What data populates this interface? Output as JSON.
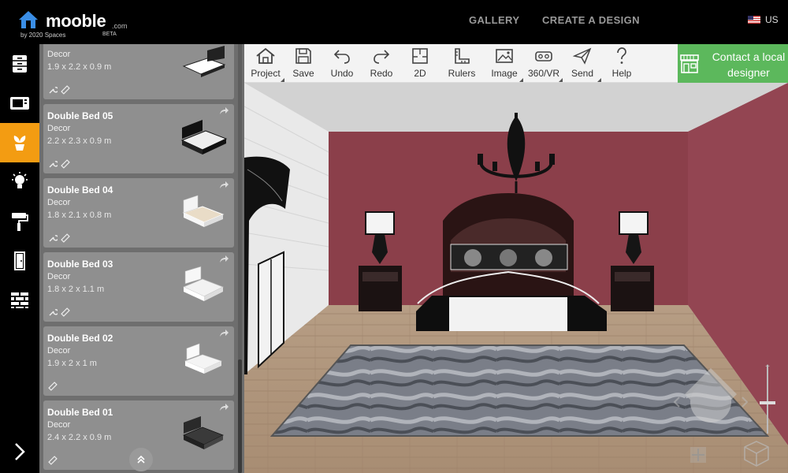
{
  "brand": {
    "name": "mooble",
    "tld": ".com",
    "byline": "by 2020 Spaces",
    "tag": "BETA"
  },
  "nav": {
    "gallery": "GALLERY",
    "create": "CREATE A DESIGN",
    "locale": "US"
  },
  "rail": {
    "items": [
      {
        "icon": "cabinet-icon"
      },
      {
        "icon": "microwave-icon"
      },
      {
        "icon": "plant-icon",
        "active": true
      },
      {
        "icon": "lightbulb-icon"
      },
      {
        "icon": "paint-roller-icon"
      },
      {
        "icon": "door-icon"
      },
      {
        "icon": "brick-wall-icon"
      }
    ],
    "expand_icon": "chevron-right-icon"
  },
  "catalog": {
    "items": [
      {
        "title": "",
        "category": "Decor",
        "dims": "1.9 x 2.2 x 0.9 m"
      },
      {
        "title": "Double Bed 05",
        "category": "Decor",
        "dims": "2.2 x 2.3 x 0.9 m"
      },
      {
        "title": "Double Bed 04",
        "category": "Decor",
        "dims": "1.8 x 2.1 x 0.8 m"
      },
      {
        "title": "Double Bed 03",
        "category": "Decor",
        "dims": "1.8 x 2 x 1.1 m"
      },
      {
        "title": "Double Bed 02",
        "category": "Decor",
        "dims": "1.9 x 2 x 1 m"
      },
      {
        "title": "Double Bed 01",
        "category": "Decor",
        "dims": "2.4 x 2.2 x 0.9 m"
      }
    ]
  },
  "toolbar": {
    "project": "Project",
    "save": "Save",
    "undo": "Undo",
    "redo": "Redo",
    "plan2d": "2D",
    "rulers": "Rulers",
    "image": "Image",
    "vr": "360/VR",
    "send": "Send",
    "help": "Help"
  },
  "contact": {
    "label": "Contact a local designer"
  },
  "colors": {
    "accent_orange": "#f39c12",
    "contact_green": "#5cb85c",
    "wall_red": "#8b3f4a",
    "panel_grey": "#8f8f8f"
  }
}
